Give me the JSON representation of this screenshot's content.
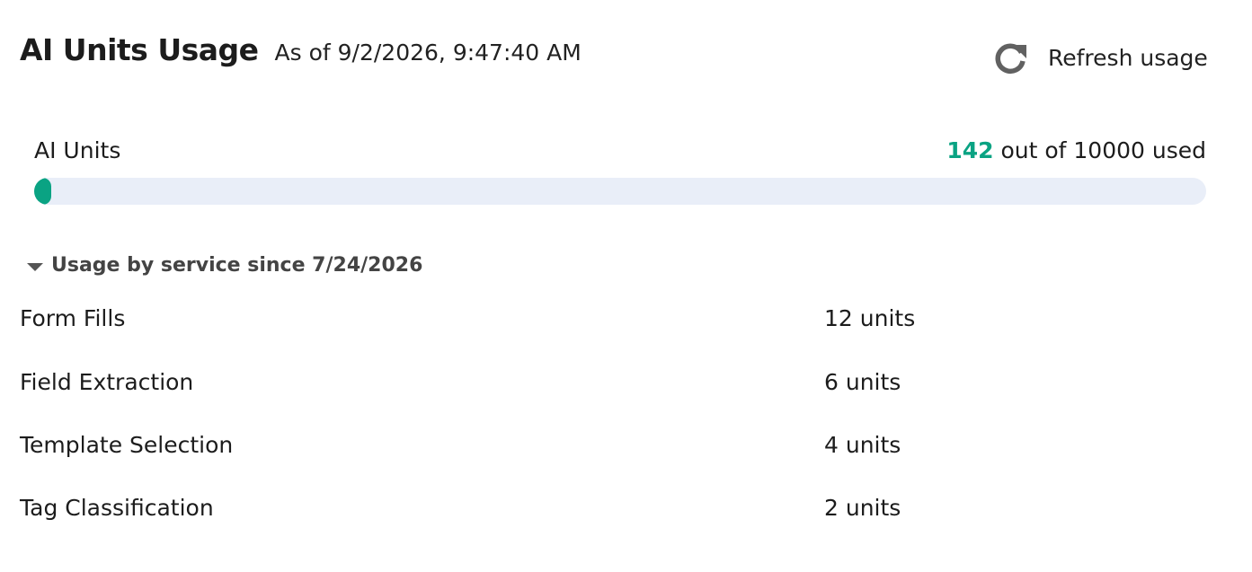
{
  "header": {
    "title": "AI Units Usage",
    "as_of": "As of 9/2/2026, 9:47:40 AM"
  },
  "refresh": {
    "icon": "refresh-icon",
    "label": "Refresh usage"
  },
  "usage": {
    "label": "AI Units",
    "used": "142",
    "summary_rest": " out of 10000 used",
    "used_value": 142,
    "total_value": 10000,
    "accent_color": "#0aa383",
    "track_color": "#e9eef8"
  },
  "services": {
    "toggle_icon": "caret-down-icon",
    "heading": "Usage by service since 7/24/2026",
    "rows": [
      {
        "name": "Form Fills",
        "value": "12 units"
      },
      {
        "name": "Field Extraction",
        "value": "6 units"
      },
      {
        "name": "Template Selection",
        "value": "4 units"
      },
      {
        "name": "Tag Classification",
        "value": "2 units"
      }
    ]
  }
}
